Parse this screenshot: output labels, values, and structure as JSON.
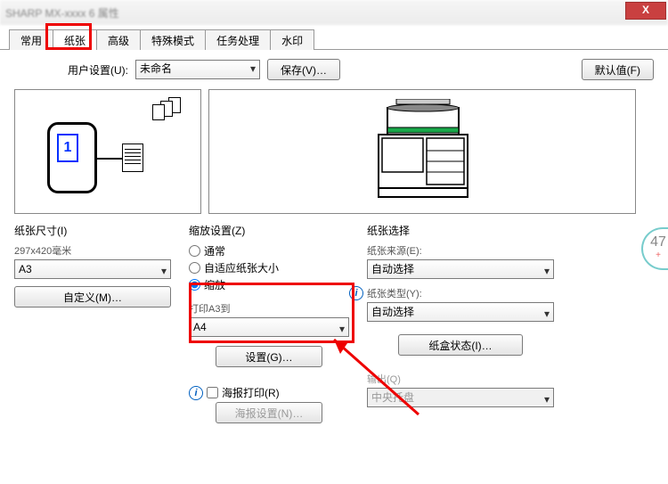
{
  "titlebar": {
    "text": "SHARP MX-xxxx 6 属性",
    "close": "X"
  },
  "tabs": [
    "常用",
    "纸张",
    "高级",
    "特殊模式",
    "任务处理",
    "水印"
  ],
  "active_tab_index": 1,
  "user_settings": {
    "label": "用户设置(U):",
    "value": "未命名",
    "save_btn": "保存(V)…",
    "default_btn": "默认值(F)"
  },
  "preview": {
    "page_number": "1"
  },
  "paper_size": {
    "title": "纸张尺寸(I)",
    "dims": "297x420毫米",
    "value": "A3",
    "custom_btn": "自定义(M)…"
  },
  "zoom": {
    "title": "缩放设置(Z)",
    "opt_normal": "通常",
    "opt_fit": "自适应纸张大小",
    "opt_zoom": "缩放",
    "print_to_label": "打印A3到",
    "print_to_value": "A4",
    "settings_btn": "设置(G)…",
    "poster_checkbox": "海报打印(R)",
    "poster_btn": "海报设置(N)…"
  },
  "paper_select": {
    "title": "纸张选择",
    "source_label": "纸张来源(E):",
    "source_value": "自动选择",
    "type_label": "纸张类型(Y):",
    "type_value": "自动选择",
    "status_btn": "纸盒状态(I)…",
    "output_label": "输出(Q)",
    "output_value": "中央托盘"
  },
  "side_badge": {
    "num": "47",
    "plus": "+"
  }
}
